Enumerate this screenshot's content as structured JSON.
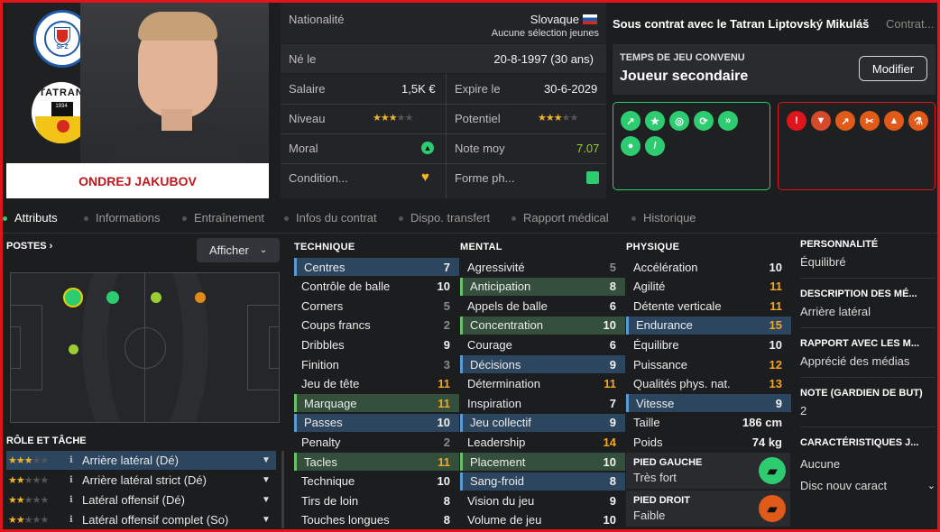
{
  "player": {
    "name": "ONDREJ JAKUBOV"
  },
  "info": {
    "nationality_label": "Nationalité",
    "nationality_value": "Slovaque",
    "nationality_sub": "Aucune sélection jeunes",
    "born_label": "Né le",
    "born_value": "20-8-1997 (30 ans)",
    "salary_label": "Salaire",
    "salary_value": "1,5K €",
    "expires_label": "Expire le",
    "expires_value": "30-6-2029",
    "level_label": "Niveau",
    "level_stars": 2.5,
    "potential_label": "Potentiel",
    "potential_stars": 2.5,
    "moral_label": "Moral",
    "rating_label": "Note moy",
    "rating_value": "7.07",
    "condition_label": "Condition...",
    "form_label": "Forme ph..."
  },
  "contract": {
    "title": "Sous contrat avec le Tatran Liptovský Mikuláš",
    "right": "Contrat...",
    "playtime_label": "TEMPS DE JEU CONVENU",
    "playtime_value": "Joueur secondaire",
    "modify_button": "Modifier"
  },
  "colors": {
    "accent": "#2ecc71",
    "alert": "#e0151c",
    "highlight_orange": "#f5a623",
    "panel": "#2a2b2e"
  },
  "badge_icons": {
    "positive": [
      "sprint-icon",
      "star-icon",
      "target-icon",
      "stamina-icon",
      "passing-icon",
      "brain-icon",
      "pen-icon"
    ],
    "negative": [
      "no-ball-icon",
      "shield-icon",
      "trend-icon",
      "scissors-icon",
      "header-icon",
      "flask-icon"
    ]
  },
  "tabs": [
    "Attributs",
    "Informations",
    "Entraînement",
    "Infos du contrat",
    "Dispo. transfert",
    "Rapport médical",
    "Historique"
  ],
  "positions": {
    "title": "POSTES ›",
    "display_button": "Afficher"
  },
  "roles": {
    "title": "RÔLE ET TÂCHE",
    "items": [
      {
        "label": "Arrière latéral (Dé)",
        "stars": 2.5
      },
      {
        "label": "Arrière latéral strict (Dé)",
        "stars": 2
      },
      {
        "label": "Latéral offensif (Dé)",
        "stars": 2
      },
      {
        "label": "Latéral offensif complet (So)",
        "stars": 2
      }
    ]
  },
  "technique": {
    "title": "TECHNIQUE",
    "items": [
      {
        "name": "Centres",
        "value": "7"
      },
      {
        "name": "Contrôle de balle",
        "value": "10"
      },
      {
        "name": "Corners",
        "value": "5"
      },
      {
        "name": "Coups francs",
        "value": "2"
      },
      {
        "name": "Dribbles",
        "value": "9"
      },
      {
        "name": "Finition",
        "value": "3"
      },
      {
        "name": "Jeu de tête",
        "value": "11"
      },
      {
        "name": "Marquage",
        "value": "11"
      },
      {
        "name": "Passes",
        "value": "10"
      },
      {
        "name": "Penalty",
        "value": "2"
      },
      {
        "name": "Tacles",
        "value": "11"
      },
      {
        "name": "Technique",
        "value": "10"
      },
      {
        "name": "Tirs de loin",
        "value": "8"
      },
      {
        "name": "Touches longues",
        "value": "8"
      }
    ]
  },
  "mental": {
    "title": "MENTAL",
    "items": [
      {
        "name": "Agressivité",
        "value": "5"
      },
      {
        "name": "Anticipation",
        "value": "8"
      },
      {
        "name": "Appels de balle",
        "value": "6"
      },
      {
        "name": "Concentration",
        "value": "10"
      },
      {
        "name": "Courage",
        "value": "6"
      },
      {
        "name": "Décisions",
        "value": "9"
      },
      {
        "name": "Détermination",
        "value": "11"
      },
      {
        "name": "Inspiration",
        "value": "7"
      },
      {
        "name": "Jeu collectif",
        "value": "9"
      },
      {
        "name": "Leadership",
        "value": "14"
      },
      {
        "name": "Placement",
        "value": "10"
      },
      {
        "name": "Sang-froid",
        "value": "8"
      },
      {
        "name": "Vision du jeu",
        "value": "9"
      },
      {
        "name": "Volume de jeu",
        "value": "10"
      }
    ]
  },
  "physique": {
    "title": "PHYSIQUE",
    "items": [
      {
        "name": "Accélération",
        "value": "10"
      },
      {
        "name": "Agilité",
        "value": "11"
      },
      {
        "name": "Détente verticale",
        "value": "11"
      },
      {
        "name": "Endurance",
        "value": "15"
      },
      {
        "name": "Équilibre",
        "value": "10"
      },
      {
        "name": "Puissance",
        "value": "12"
      },
      {
        "name": "Qualités phys. nat.",
        "value": "13"
      },
      {
        "name": "Vitesse",
        "value": "9"
      },
      {
        "name": "Taille",
        "value": "186 cm"
      },
      {
        "name": "Poids",
        "value": "74 kg"
      }
    ],
    "left_foot_label": "PIED GAUCHE",
    "left_foot_value": "Très fort",
    "right_foot_label": "PIED DROIT",
    "right_foot_value": "Faible"
  },
  "side": {
    "personality_label": "PERSONNALITÉ",
    "personality_value": "Équilibré",
    "description_label": "DESCRIPTION DES MÉ...",
    "description_value": "Arrière latéral",
    "media_label": "RAPPORT AVEC LES M...",
    "media_value": "Apprécié des médias",
    "gk_label": "NOTE (GARDIEN DE BUT)",
    "gk_value": "2",
    "traits_label": "CARACTÉRISTIQUES J...",
    "traits_value": "Aucune",
    "traits_dropdown": "Disc nouv caract"
  },
  "club": {
    "crest_text": "TATRAN",
    "crest_year": "1934",
    "fed_text": "SFZ"
  }
}
